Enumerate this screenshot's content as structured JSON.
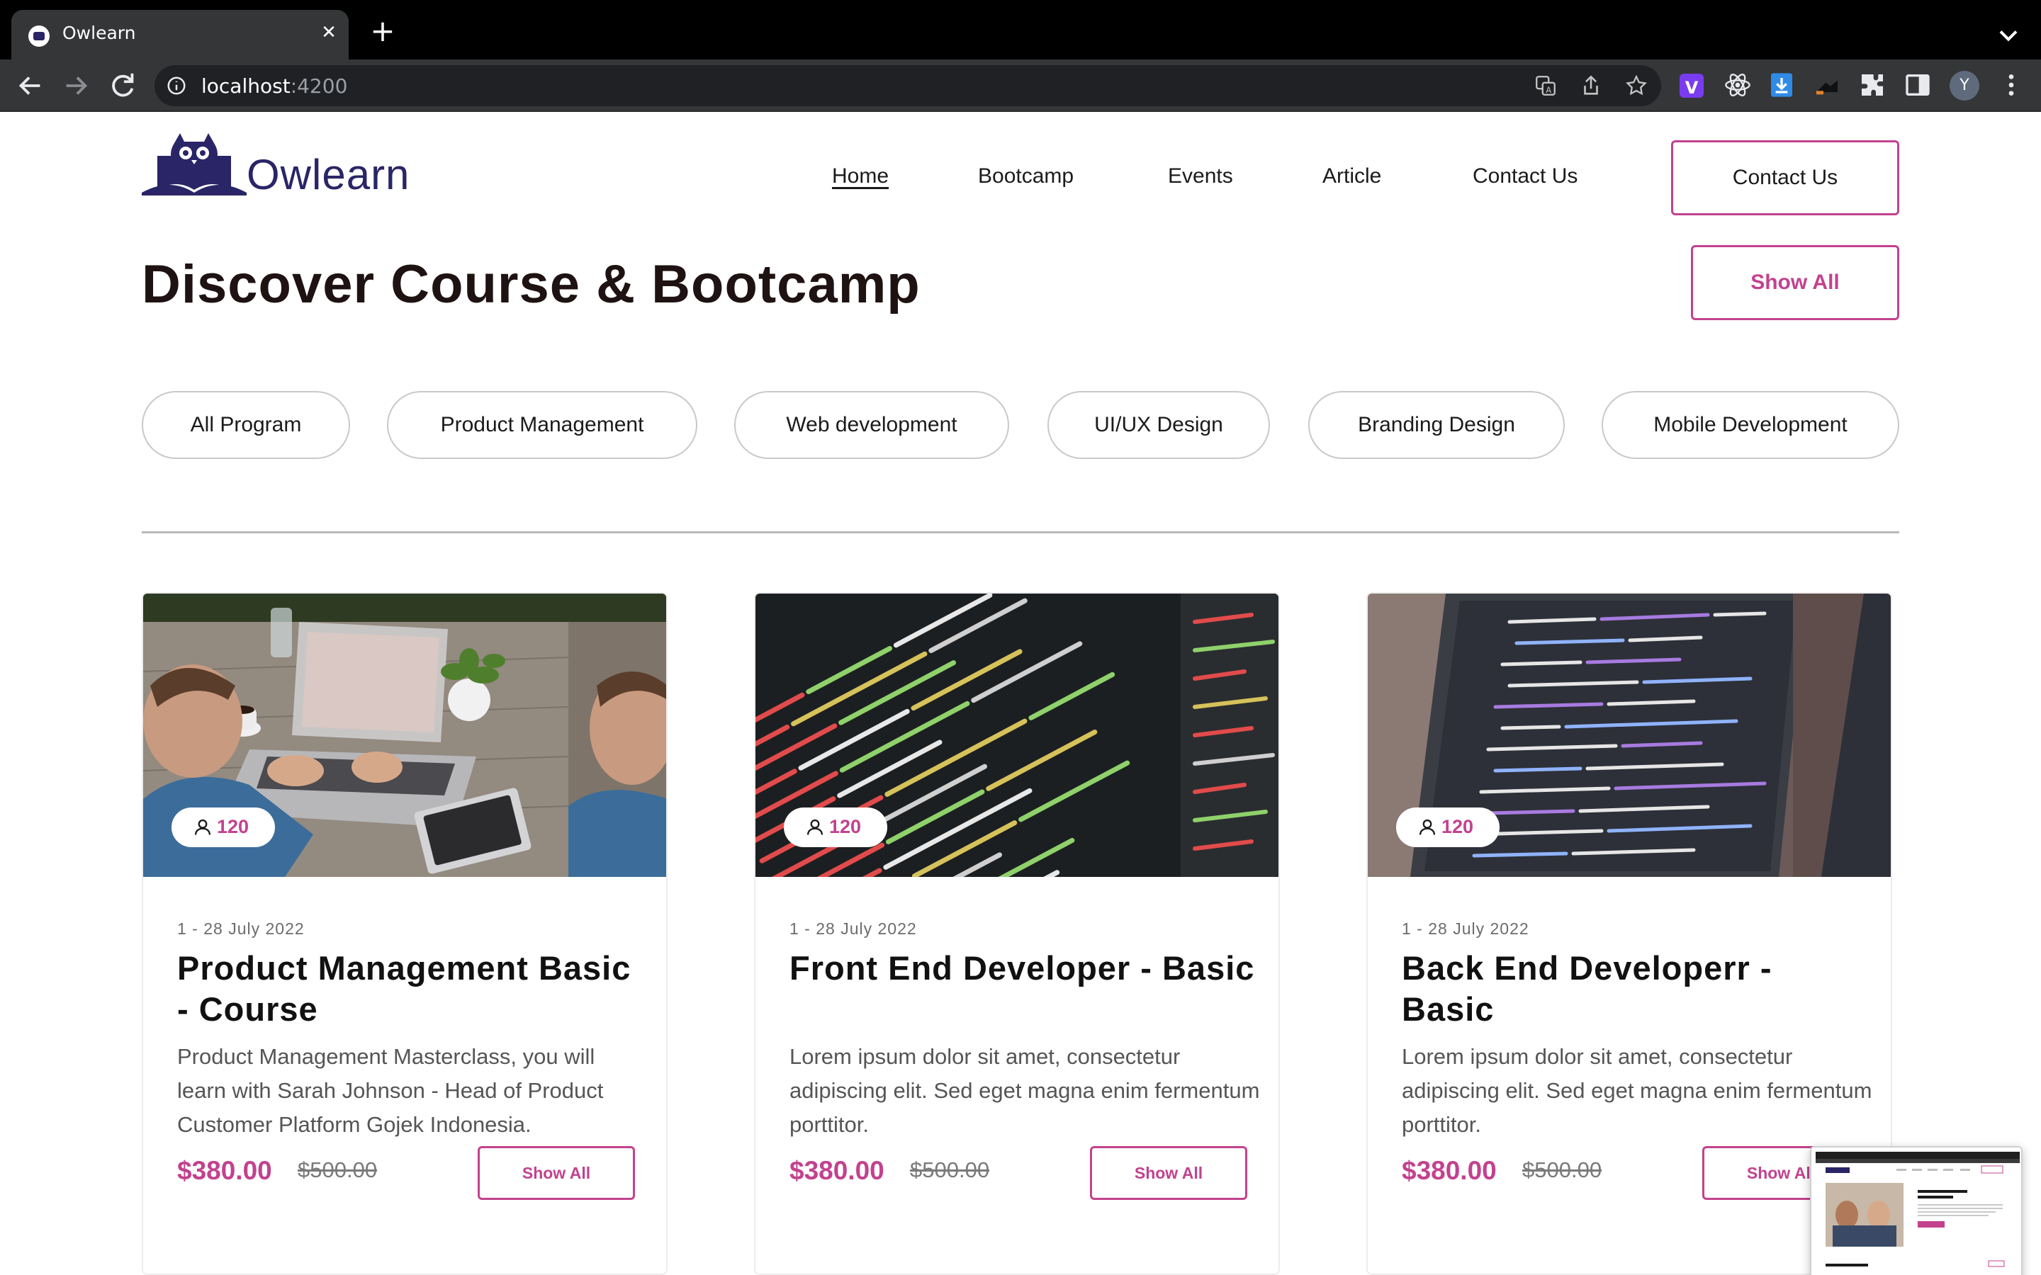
{
  "browser": {
    "tab_title": "Owlearn",
    "tab_close": "✕",
    "new_tab": "+",
    "url_host": "localhost",
    "url_port": ":4200",
    "profile_initial": "Y",
    "ext_v_label": "V"
  },
  "header": {
    "logo_text": "Owlearn",
    "nav": [
      "Home",
      "Bootcamp",
      "Events",
      "Article",
      "Contact Us"
    ],
    "contact_button": "Contact Us"
  },
  "section": {
    "title": "Discover Course & Bootcamp",
    "show_all": "Show All"
  },
  "filters": [
    "All Program",
    "Product Management",
    "Web development",
    "UI/UX Design",
    "Branding Design",
    "Mobile Development"
  ],
  "cards": [
    {
      "participants": "120",
      "date": "1 - 28 July 2022",
      "title": "Product Management Basic - Course",
      "description": "Product Management Masterclass, you will learn with Sarah Johnson - Head of Product Customer Platform Gojek Indonesia.",
      "price": "$380.00",
      "old_price": "$500.00",
      "button": "Show All"
    },
    {
      "participants": "120",
      "date": "1 - 28 July 2022",
      "title": "Front End Developer - Basic",
      "description": "Lorem ipsum dolor sit amet, consectetur adipiscing elit. Sed eget magna enim fermentum porttitor.",
      "price": "$380.00",
      "old_price": "$500.00",
      "button": "Show All"
    },
    {
      "participants": "120",
      "date": "1 - 28 July 2022",
      "title": "Back End Developerr - Basic",
      "description": "Lorem ipsum dolor sit amet, consectetur adipiscing elit. Sed eget magna enim fermentum porttitor.",
      "price": "$380.00",
      "old_price": "$500.00",
      "button": "Show All"
    }
  ],
  "colors": {
    "brand": "#2a2567",
    "accent": "#c2428e"
  }
}
